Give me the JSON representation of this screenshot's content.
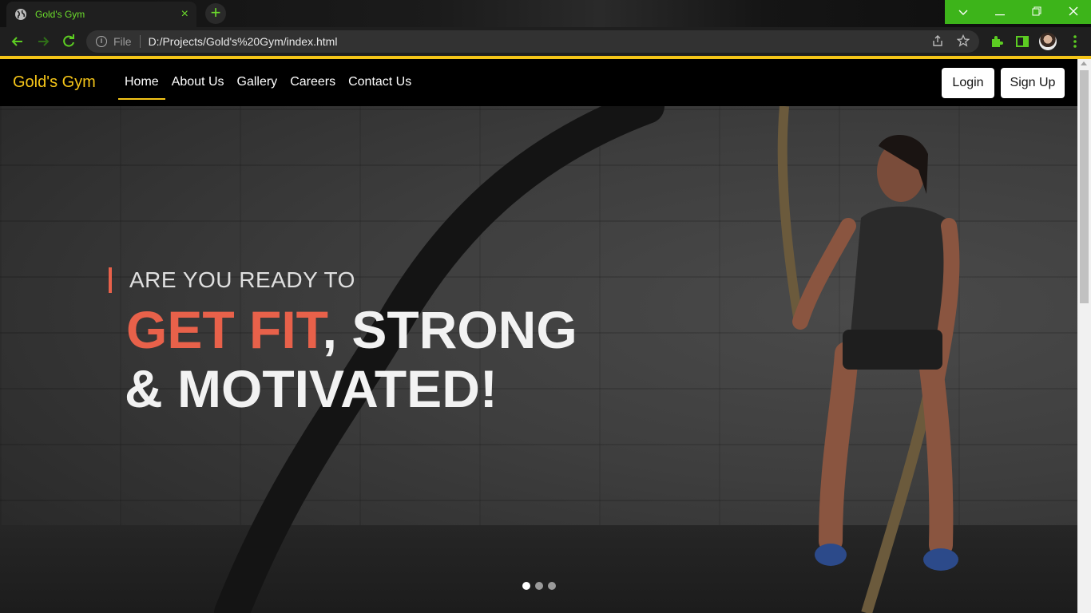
{
  "browser": {
    "tab_title": "Gold's Gym",
    "tab_close": "×",
    "new_tab": "+",
    "protocol_label": "File",
    "url": "D:/Projects/Gold's%20Gym/index.html",
    "accent_color": "#3db41a"
  },
  "navbar": {
    "brand": "Gold's Gym",
    "links": [
      "Home",
      "About Us",
      "Gallery",
      "Careers",
      "Contact Us"
    ],
    "active_link": "Home",
    "login_label": "Login",
    "signup_label": "Sign Up",
    "brand_color": "#f5c518"
  },
  "hero": {
    "line1": "ARE YOU READY TO",
    "line2_accent": "GET FIT",
    "line2_rest": ", STRONG",
    "line3": "& MOTIVATED!",
    "accent_color": "#e8614a",
    "slides_total": 3,
    "active_slide": 1
  }
}
